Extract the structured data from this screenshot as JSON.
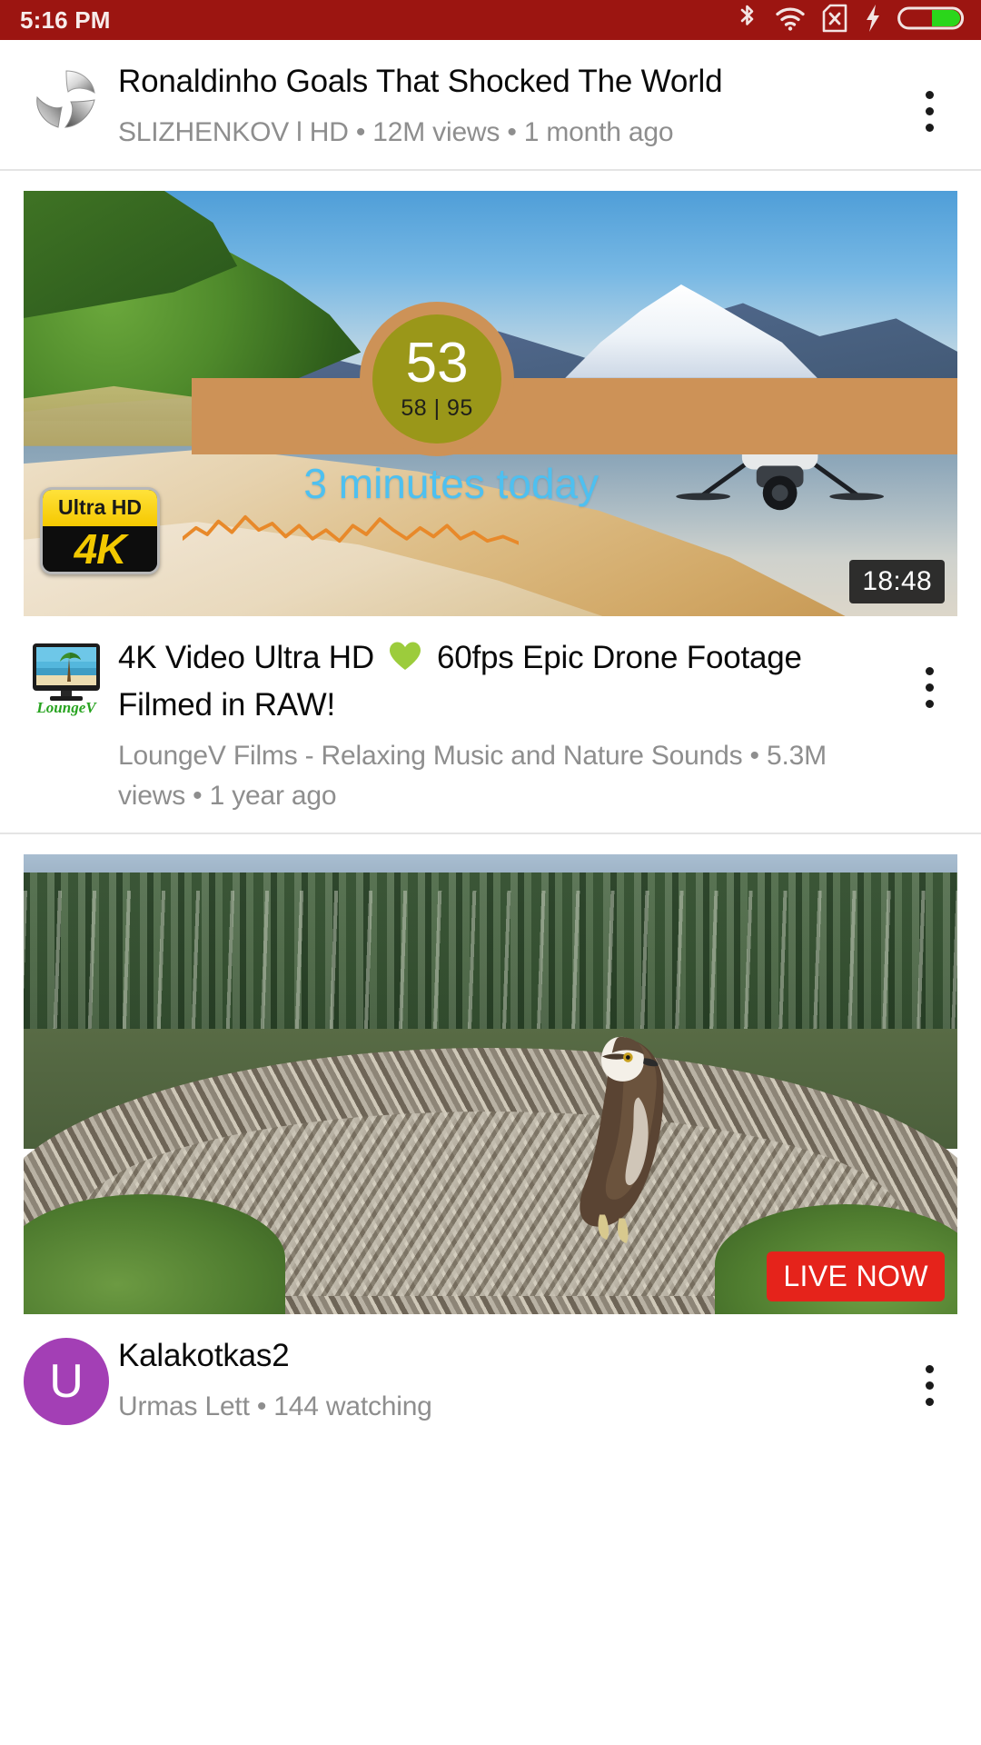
{
  "status_bar": {
    "time": "5:16 PM",
    "background_color": "#9c1511",
    "icons": [
      "bluetooth-icon",
      "wifi-icon",
      "no-sim-icon",
      "charging-bolt-icon",
      "battery-icon"
    ],
    "battery_color": "#2bd61b"
  },
  "feed": {
    "items": [
      {
        "type": "compact",
        "avatar": "slizhenkov-pinwheel-avatar",
        "title": "Ronaldinho Goals That Shocked The World",
        "meta": "SLIZHENKOV l HD • 12M views • 1 month ago",
        "channel": "SLIZHENKOV l HD",
        "views": "12M views",
        "age": "1 month ago",
        "menu": "more-options"
      },
      {
        "type": "card",
        "avatar": "loungev-tv-avatar",
        "avatar_label": "LoungeV",
        "title": "4K Video Ultra HD 💚 60fps Epic Drone Footage Filmed in RAW!",
        "title_pre": "4K Video Ultra HD",
        "title_post": "60fps Epic Drone Footage Filmed in RAW!",
        "meta": "LoungeV Films - Relaxing Music and Nature Sounds • 5.3M views • 1 year ago",
        "channel": "LoungeV Films - Relaxing Music and Nature Sounds",
        "views": "5.3M views",
        "age": "1 year ago",
        "duration": "18:48",
        "quality_badge": {
          "top": "Ultra HD",
          "bottom": "4K"
        },
        "overlay": {
          "score": "53",
          "range": "58 | 95",
          "caption": "3 minutes today",
          "bar_color": "#cd9257",
          "circle_color": "#9a9719",
          "caption_color": "#4ec0f0",
          "spark_color": "#e8892a"
        },
        "menu": "more-options"
      },
      {
        "type": "card",
        "avatar": "kalakotkas-letter-avatar",
        "avatar_letter": "U",
        "avatar_color": "#a33fb5",
        "title": "Kalakotkas2",
        "meta": "Urmas Lett • 144 watching",
        "channel": "Urmas Lett",
        "viewers": "144 watching",
        "live_badge": "LIVE NOW",
        "live_badge_color": "#e5231b",
        "menu": "more-options"
      }
    ]
  }
}
